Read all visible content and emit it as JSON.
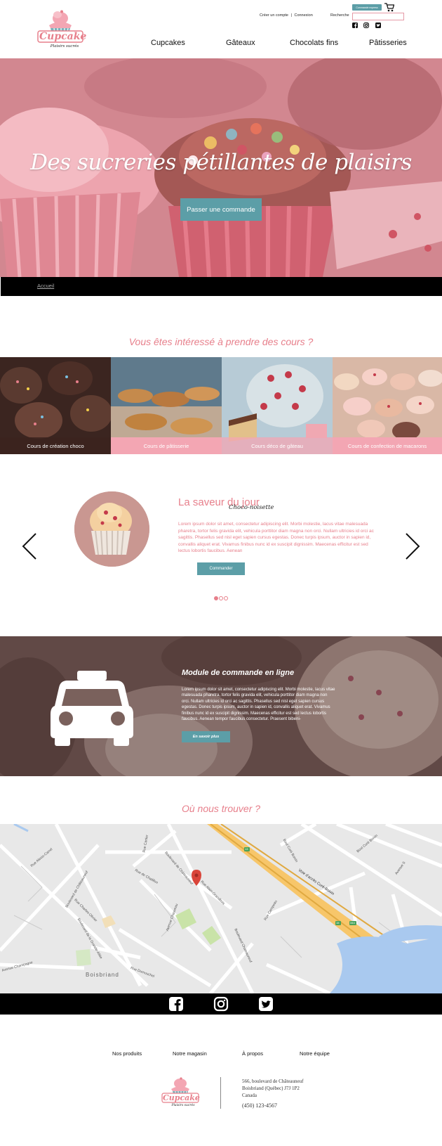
{
  "header": {
    "logo": {
      "name": "Cupcake",
      "tagline": "Plaisirs sucrés"
    },
    "account": {
      "create_label": "Créer un compte",
      "separator": "|",
      "login_label": "Connexion"
    },
    "search": {
      "label": "Recherche",
      "placeholder": ""
    },
    "order_button_label": "Commande express",
    "cart_icon": "cart-icon",
    "social_icons": [
      "facebook-icon",
      "instagram-icon",
      "twitter-icon"
    ],
    "nav": [
      "Cupcakes",
      "Gâteaux",
      "Chocolats fins",
      "Pâtisseries"
    ]
  },
  "hero": {
    "title": "Des sucreries pétillantes de plaisirs",
    "button_label": "Passer une commande"
  },
  "breadcrumb": {
    "label": "Accueil"
  },
  "courses": {
    "title": "Vous êtes intéressé à prendre des cours ?",
    "items": [
      {
        "label": "Cours de création choco"
      },
      {
        "label": "Cours de pâtisserie"
      },
      {
        "label": "Cours déco de gâteau"
      },
      {
        "label": "Cours de confection de macarons"
      }
    ]
  },
  "daily": {
    "title": "La saveur du jour",
    "subtitle": "Choco-noisette",
    "text": "Lorem ipsum dolor sit amet, consectetur adipiscing elit. Morbi molestie, lacus vitae malesuada pharetra, tortor felis gravida elit, vehicula porttitor diam magna non orci. Nullam ultricies id orci ac sagittis. Phasellus sed nisl eget sapien cursus egestas. Donec turpis ipsum, auctor in sapien id, convallis aliquet erat. Vivamus finibus nunc id ex suscipit dignissim. Maecenas efficitur est sed lectus lobortis faucibus. Aenean",
    "button_label": "Commander",
    "active_slide": 1,
    "slide_count": 3
  },
  "module": {
    "title": "Module de commande en ligne",
    "text": "Lorem ipsum dolor sit amet, consectetur adipiscing elit. Morbi molestie, lacus vitae malesuada pharetra, tortor felis gravida elit, vehicula porttitor diam magna non orci. Nullam ultricies id orci ac sagittis. Phasellus sed nisl eget sapien cursus egestas. Donec turpis ipsum, auctor in sapien id, convallis aliquet erat. Vivamus finibus nunc id ex suscipit dignissim. Maecenas efficitur est sed lectus lobortis faucibus. Aenean tempor faucibus consectetur. Praesent bibeni-",
    "button_label": "En savoir plus"
  },
  "map": {
    "title": "Où nous trouver ?",
    "labels": [
      "Boulevard de Châteauneuf",
      "Rue Alexis-Carrel",
      "Rue Charles-Olivier",
      "Boulevard de la Grande-Allée",
      "Avenue Champagne",
      "Rue Dumouchel",
      "Rue de Chatillon",
      "Avenue Chauveau",
      "Rue Alain-Grandbois",
      "Rue Campeau",
      "Boulevard Chateauneuf",
      "Rue Cartier",
      "Voie d'accès Curé-Boivin",
      "Boul Curé Boivin",
      "Avenue S",
      "Boisbriand",
      "Rue Dumouchel"
    ],
    "road_shields": [
      "13",
      "15",
      "344"
    ]
  },
  "social_bar": [
    "facebook-icon",
    "instagram-icon",
    "twitter-icon"
  ],
  "footer": {
    "links": [
      "Nos produits",
      "Notre magasin",
      "À propos",
      "Notre équipe"
    ],
    "address": [
      "566, boulevard de Châteauneuf",
      "Boisbriand (Québec) J7J 1P2",
      "Canada"
    ],
    "phone": "(450) 123-4567"
  },
  "colors": {
    "accent_pink": "#e77f8b",
    "teal": "#5c9ea7",
    "black": "#000000",
    "course_label_pink": "#f3a6b3"
  }
}
